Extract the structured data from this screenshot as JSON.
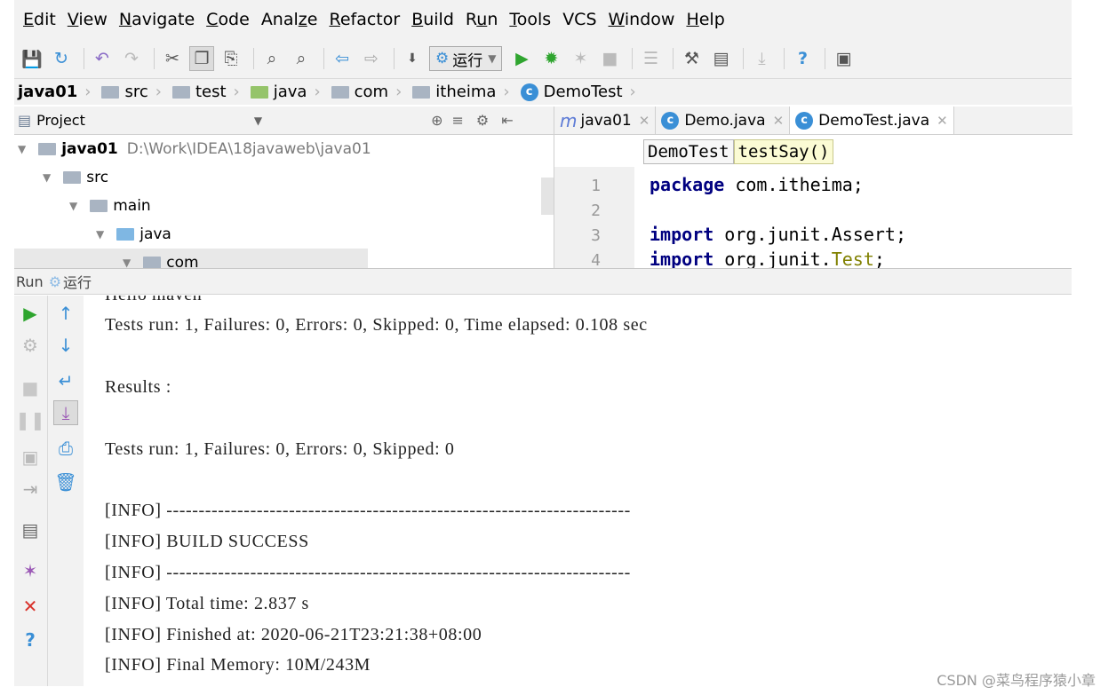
{
  "menubar": {
    "items": [
      "Edit",
      "View",
      "Navigate",
      "Code",
      "Analyze",
      "Refactor",
      "Build",
      "Run",
      "Tools",
      "VCS",
      "Window",
      "Help"
    ],
    "mnemonics": [
      "E",
      "V",
      "N",
      "C",
      "z",
      "R",
      "B",
      "u",
      "T",
      "",
      "W",
      "H"
    ]
  },
  "toolbar": {
    "run_config_label": "运行",
    "icons": [
      "save-all-icon",
      "sync-icon",
      "undo-icon",
      "redo-icon",
      "cut-icon",
      "copy-icon",
      "paste-icon",
      "find-icon",
      "replace-icon",
      "back-icon",
      "forward-icon",
      "build-icon",
      "run-icon",
      "debug-icon",
      "coverage-icon",
      "stop-icon",
      "project-structure-icon",
      "settings-icon",
      "sdk-icon",
      "download-icon",
      "help-icon",
      "vcs-icon"
    ]
  },
  "breadcrumb": {
    "items": [
      "java01",
      "src",
      "test",
      "java",
      "com",
      "itheima",
      "DemoTest"
    ]
  },
  "project": {
    "header_label": "Project",
    "tree": [
      {
        "label": "java01",
        "path": "D:\\Work\\IDEA\\18javaweb\\java01"
      },
      {
        "label": "src"
      },
      {
        "label": "main"
      },
      {
        "label": "java"
      },
      {
        "label": "com"
      }
    ]
  },
  "editor": {
    "tabs": [
      "java01",
      "Demo.java",
      "DemoTest.java"
    ],
    "structure_breadcrumb": [
      "DemoTest",
      "testSay()"
    ],
    "line_numbers": [
      "1",
      "2",
      "3",
      "4"
    ],
    "lines": [
      {
        "kw": "package",
        "rest": " com.itheima;"
      },
      {
        "kw": "",
        "rest": ""
      },
      {
        "kw": "import",
        "rest": " org.junit.Assert;"
      },
      {
        "kw": "import",
        "rest": " org.junit.",
        "ann": "Test",
        "tail": ";"
      }
    ]
  },
  "run": {
    "label": "Run",
    "config_name": "运行",
    "console": [
      "Hello maven",
      "Tests run: 1, Failures: 0, Errors: 0, Skipped: 0, Time elapsed: 0.108 sec",
      "Results :",
      "Tests run: 1, Failures: 0, Errors: 0, Skipped: 0",
      "[INFO] ------------------------------------------------------------------------",
      "[INFO] BUILD SUCCESS",
      "[INFO] ------------------------------------------------------------------------",
      "[INFO] Total time: 2.837 s",
      "[INFO] Finished at: 2020-06-21T23:21:38+08:00",
      "[INFO] Final Memory: 10M/243M"
    ]
  },
  "watermark": "CSDN @菜鸟程序猿小章",
  "colors": {
    "keyword": "#000080",
    "annotation": "#808000",
    "run_green": "#2fa52f",
    "error_red": "#d9322b",
    "action_blue": "#3a8fd6"
  }
}
